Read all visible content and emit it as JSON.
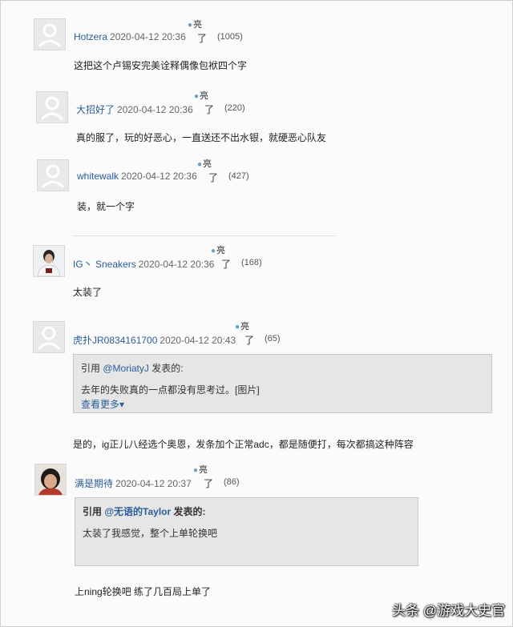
{
  "comments": [
    {
      "user": "Hotzera",
      "time": "2020-04-12 20:36",
      "liang": "亮",
      "liao": "了",
      "count": "(1005)",
      "text": "这把这个卢锡安完美诠释偶像包袱四个字"
    },
    {
      "user": "大招好了",
      "time": "2020-04-12 20:36",
      "liang": "亮",
      "liao": "了",
      "count": "(220)",
      "text": "真的服了，玩的好恶心，一直送还不出水银，就硬恶心队友"
    },
    {
      "user": "whitewalk",
      "time": "2020-04-12 20:36",
      "liang": "亮",
      "liao": "了",
      "count": "(427)",
      "text": "装，就一个字"
    },
    {
      "user": "IG丶 Sneakers",
      "time": "2020-04-12 20:36",
      "liang": "亮",
      "liao": "了",
      "count": "(168)",
      "text": "太装了"
    },
    {
      "user": "虎扑JR0834161700",
      "time": "2020-04-12 20:43",
      "liang": "亮",
      "liao": "了",
      "count": "(65)",
      "quote": {
        "prefix": "引用 ",
        "user": "@MoriatyJ",
        "suffix": " 发表的:",
        "content": "去年的失败真的一点都没有思考过。[图片]",
        "more": "查看更多▾"
      },
      "text": "是的，ig正儿八经选个奥恩，发条加个正常adc，都是随便打，每次都搞这种阵容"
    },
    {
      "user": "满是期待",
      "time": "2020-04-12 20:37",
      "liang": "亮",
      "liao": "了",
      "count": "(86)",
      "quote": {
        "prefix": "引用 ",
        "user": "@无语的Taylor",
        "suffix": " 发表的:",
        "content": "太装了我感觉，整个上单轮换吧"
      },
      "text": "上ning轮换吧 练了几百局上单了"
    }
  ],
  "watermark": "头条 @游戏大史官"
}
